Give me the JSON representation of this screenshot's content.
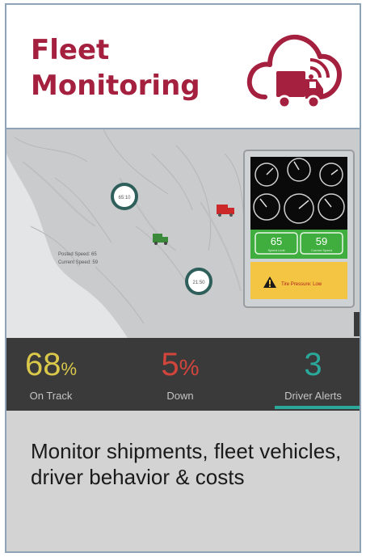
{
  "header": {
    "title_line1": "Fleet",
    "title_line2": "Monitoring",
    "icon": "cloud-truck-icon"
  },
  "map": {
    "marker_a": "65:10",
    "marker_b": "21:50",
    "posted_speed": "Posted Speed: 65",
    "current_speed": "Current Speed: 59",
    "gauge_values": [
      "65",
      "59"
    ],
    "gauge_sub_labels": [
      "Speed Limit",
      "Current Speed"
    ],
    "alert_text": "Tire Pressure: Low",
    "icons": [
      "location-pin-icon",
      "truck-icon",
      "dashboard-gauges-icon",
      "warning-icon"
    ]
  },
  "stats": [
    {
      "value": "68",
      "unit": "%",
      "label": "On Track",
      "color": "#d9c84a"
    },
    {
      "value": "5",
      "unit": "%",
      "label": "Down",
      "color": "#d2453c"
    },
    {
      "value": "3",
      "unit": "",
      "label": "Driver Alerts",
      "color": "#2aa89a"
    }
  ],
  "description": "Monitor shipments, fleet vehicles, driver behavior & costs",
  "colors": {
    "brand": "#a4203e",
    "stats_bg": "#3a3a3a",
    "description_bg": "#d3d3d3",
    "border": "#8fa3b7",
    "active_underline": "#2aa89a"
  }
}
